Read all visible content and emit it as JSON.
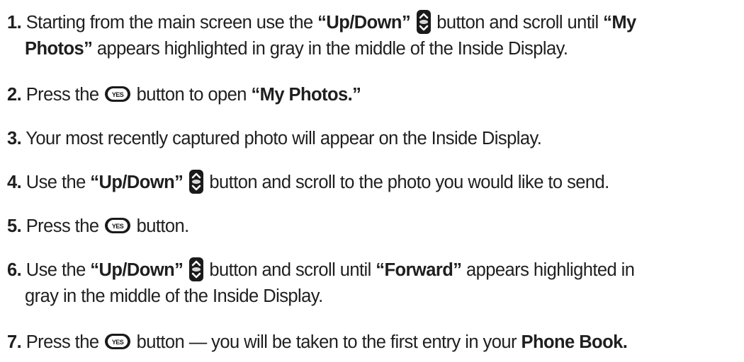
{
  "steps": [
    {
      "num": "1.",
      "t1": "Starting from the main screen use the ",
      "b1": "“Up/Down”",
      "t2": " button and scroll until ",
      "b2": "“My",
      "b3": "Photos”",
      "t3": " appears highlighted in gray in the middle of the Inside Display."
    },
    {
      "num": "2.",
      "t1": "Press  the ",
      "t2": " button to open ",
      "b1": "“My Photos.”"
    },
    {
      "num": "3.",
      "t1": "Your most recently captured photo will appear on the Inside Display."
    },
    {
      "num": "4.",
      "t1": "Use the ",
      "b1": "“Up/Down”",
      "t2": " button and scroll to the photo you would like to send."
    },
    {
      "num": "5.",
      "t1": "Press  the ",
      "t2": " button."
    },
    {
      "num": "6.",
      "t1": "Use the ",
      "b1": "“Up/Down”",
      "t2": " button and scroll until ",
      "b2": "“Forward”",
      "t3": " appears highlighted in",
      "t4": "gray in the middle of the Inside Display."
    },
    {
      "num": "7.",
      "t1": "Press  the ",
      "t2": " button — you will be taken to the first entry in your ",
      "b1": "Phone Book."
    }
  ],
  "icons": {
    "up_down": "up-down-rocker-icon",
    "yes": "yes-key-icon",
    "yes_key_text": "YES"
  }
}
